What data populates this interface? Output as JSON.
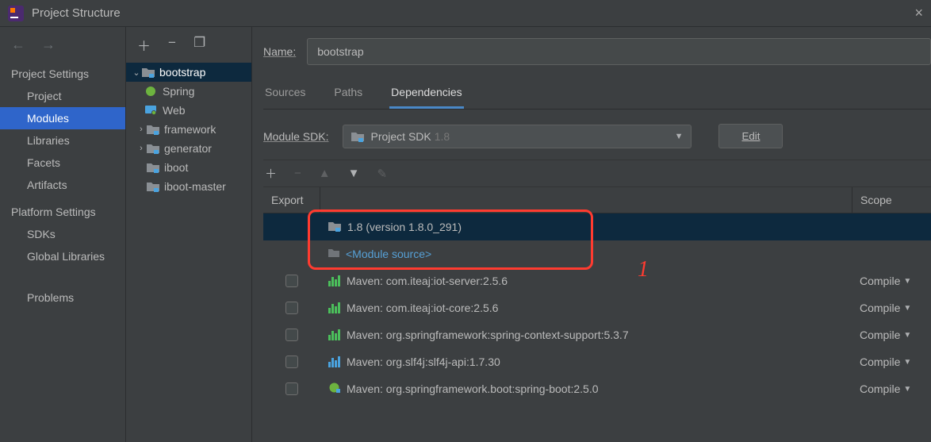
{
  "window": {
    "title": "Project Structure"
  },
  "sidebar": {
    "groups": [
      {
        "label": "Project Settings",
        "items": [
          "Project",
          "Modules",
          "Libraries",
          "Facets",
          "Artifacts"
        ]
      },
      {
        "label": "Platform Settings",
        "items": [
          "SDKs",
          "Global Libraries"
        ]
      }
    ],
    "extra": [
      "Problems"
    ],
    "active": "Modules"
  },
  "tree": {
    "nodes": [
      {
        "label": "bootstrap",
        "expanded": true,
        "selected": true,
        "depth": 0
      },
      {
        "label": "Spring",
        "icon": "spring",
        "depth": 1
      },
      {
        "label": "Web",
        "icon": "web",
        "depth": 1
      },
      {
        "label": "framework",
        "expanded": false,
        "depth": 0
      },
      {
        "label": "generator",
        "expanded": false,
        "depth": 0
      },
      {
        "label": "iboot",
        "depth": 0
      },
      {
        "label": "iboot-master",
        "depth": 0
      }
    ]
  },
  "content": {
    "name_label": "Name:",
    "name_value": "bootstrap",
    "tabs": [
      "Sources",
      "Paths",
      "Dependencies"
    ],
    "active_tab": "Dependencies",
    "sdk_label": "Module SDK:",
    "sdk_dropdown": {
      "text": "Project SDK",
      "version": "1.8"
    },
    "edit_label": "Edit",
    "table": {
      "col_export": "Export",
      "col_scope": "Scope",
      "rows": [
        {
          "icon": "folder",
          "label": "1.8 (version 1.8.0_291)",
          "selected": true,
          "scope": "",
          "checkbox": false
        },
        {
          "icon": "module",
          "label": "<Module source>",
          "link": true,
          "scope": "",
          "checkbox": false
        },
        {
          "icon": "maven-green",
          "label": "Maven: com.iteaj:iot-server:2.5.6",
          "scope": "Compile",
          "checkbox": true
        },
        {
          "icon": "maven-green",
          "label": "Maven: com.iteaj:iot-core:2.5.6",
          "scope": "Compile",
          "checkbox": true
        },
        {
          "icon": "maven-green",
          "label": "Maven: org.springframework:spring-context-support:5.3.7",
          "scope": "Compile",
          "checkbox": true
        },
        {
          "icon": "maven-blue",
          "label": "Maven: org.slf4j:slf4j-api:1.7.30",
          "scope": "Compile",
          "checkbox": true
        },
        {
          "icon": "maven-boot",
          "label": "Maven: org.springframework.boot:spring-boot:2.5.0",
          "scope": "Compile",
          "checkbox": true
        }
      ]
    }
  },
  "annotation": {
    "number": "1"
  }
}
